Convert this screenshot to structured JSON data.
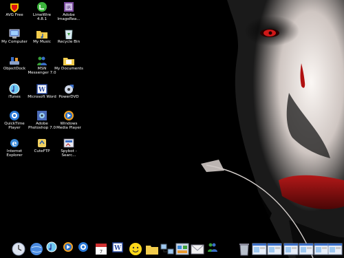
{
  "desktop": {
    "icons": [
      {
        "label": "AVG Free",
        "icon": "avg-shield-icon"
      },
      {
        "label": "LimeWire 4.8.1",
        "icon": "limewire-icon"
      },
      {
        "label": "Adobe ImageRea...",
        "icon": "adobe-imageready-icon"
      },
      {
        "label": "My Computer",
        "icon": "computer-icon"
      },
      {
        "label": "My Music",
        "icon": "music-folder-icon"
      },
      {
        "label": "Recycle Bin",
        "icon": "recycle-bin-icon"
      },
      {
        "label": "ObjectDock",
        "icon": "objectdock-icon"
      },
      {
        "label": "MSN Messenger 7.0",
        "icon": "msn-messenger-icon"
      },
      {
        "label": "My Documents",
        "icon": "documents-folder-icon"
      },
      {
        "label": "iTunes",
        "icon": "itunes-icon"
      },
      {
        "label": "Microsoft Word",
        "icon": "word-icon"
      },
      {
        "label": "PowerDVD",
        "icon": "powerdvd-icon"
      },
      {
        "label": "QuickTime Player",
        "icon": "quicktime-icon"
      },
      {
        "label": "Adobe Photoshop 7.0",
        "icon": "photoshop-icon"
      },
      {
        "label": "Windows Media Player",
        "icon": "media-player-icon"
      },
      {
        "label": "Internet Explorer",
        "icon": "internet-explorer-icon"
      },
      {
        "label": "CuteFTP",
        "icon": "cuteftp-icon"
      },
      {
        "label": "Spybot - Searc...",
        "icon": "spybot-icon"
      }
    ]
  },
  "dock": {
    "items": [
      {
        "icon": "clock-icon"
      },
      {
        "icon": "globe-icon"
      },
      {
        "icon": "itunes-icon"
      },
      {
        "icon": "media-player-icon"
      },
      {
        "icon": "quicktime-icon"
      },
      {
        "icon": "calendar-icon"
      },
      {
        "icon": "word-icon"
      },
      {
        "icon": "smiley-icon"
      },
      {
        "icon": "folder-icon"
      },
      {
        "icon": "network-icon"
      },
      {
        "icon": "control-panel-icon"
      },
      {
        "icon": "mail-icon"
      },
      {
        "icon": "msn-messenger-icon"
      },
      {
        "icon": "trash-icon"
      },
      {
        "icon": "window-thumbnail-icon"
      },
      {
        "icon": "window-thumbnail-icon"
      },
      {
        "icon": "window-thumbnail-icon"
      },
      {
        "icon": "window-thumbnail-icon"
      },
      {
        "icon": "window-thumbnail-icon"
      },
      {
        "icon": "window-thumbnail-icon"
      }
    ]
  },
  "colors": {
    "background": "#000000",
    "skin": "#f2ece8",
    "eye_red": "#d01818",
    "lips": "#8a0a0a",
    "label_text": "#ffffff"
  }
}
